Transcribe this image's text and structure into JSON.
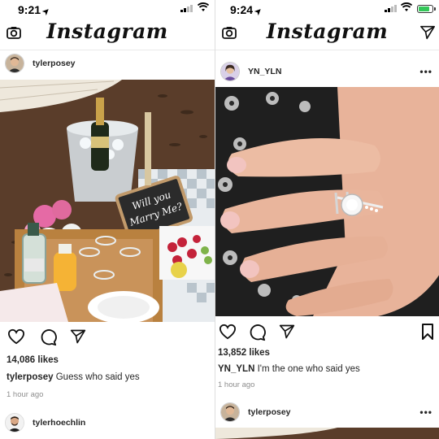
{
  "left": {
    "status": {
      "time": "9:21"
    },
    "app_title": "Instagram",
    "post": {
      "username": "tylerposey",
      "likes": "14,086 likes",
      "caption_user": "tylerposey",
      "caption_text": "Guess who said yes",
      "time_ago": "1 hour ago",
      "photo_sign_text": "Will you Marry Me?"
    },
    "next_post": {
      "username": "tylerhoechlin"
    }
  },
  "right": {
    "status": {
      "time": "9:24"
    },
    "app_title": "Instagram",
    "post": {
      "username": "YN_YLN",
      "likes": "13,852 likes",
      "caption_user": "YN_YLN",
      "caption_text": "I'm the one who said yes",
      "time_ago": "1 hour ago"
    },
    "next_post": {
      "username": "tylerposey"
    }
  },
  "colors": {
    "battery_green": "#34c759",
    "text_dark": "#262626",
    "text_muted": "#8e8e8e"
  }
}
